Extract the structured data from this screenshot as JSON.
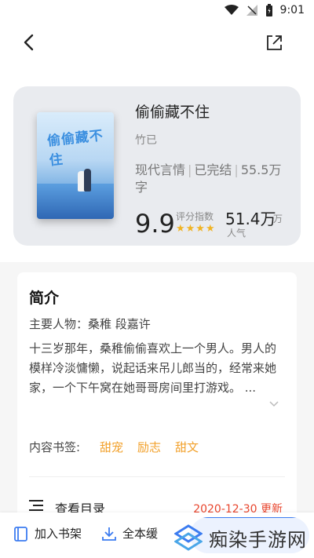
{
  "status": {
    "time": "9:01"
  },
  "book": {
    "title": "偷偷藏不住",
    "author": "竹已",
    "genre": "现代言情",
    "status": "已完结",
    "word_count": "55.5万字",
    "score": "9.9",
    "score_label": "评分指数",
    "rating_stars": 4,
    "popularity": "51.4万",
    "popularity_unit": "万",
    "popularity_label": "人气",
    "cover_text": "偷偷藏不住"
  },
  "intro": {
    "heading": "简介",
    "roles": "主要人物：桑稚 段嘉许",
    "description": "十三岁那年，桑稚偷偷喜欢上一个男人。男人的模样冷淡慵懒，说起话来吊儿郎当的，经常来她家，一个下午窝在她哥哥房间里打游戏。 ...",
    "tags_label": "内容书签:",
    "tags": [
      "甜宠",
      "励志",
      "甜文"
    ],
    "toc_label": "查看目录",
    "update_time": "2020-12-30 更新"
  },
  "bottom_bar": {
    "add_shelf": "加入书架",
    "download_all": "全本缓"
  },
  "watermark": {
    "text": "痴染手游网"
  },
  "colors": {
    "accent": "#3c7cf0",
    "tag": "#f2a02a",
    "star": "#f0b323",
    "update": "#e8452d"
  }
}
